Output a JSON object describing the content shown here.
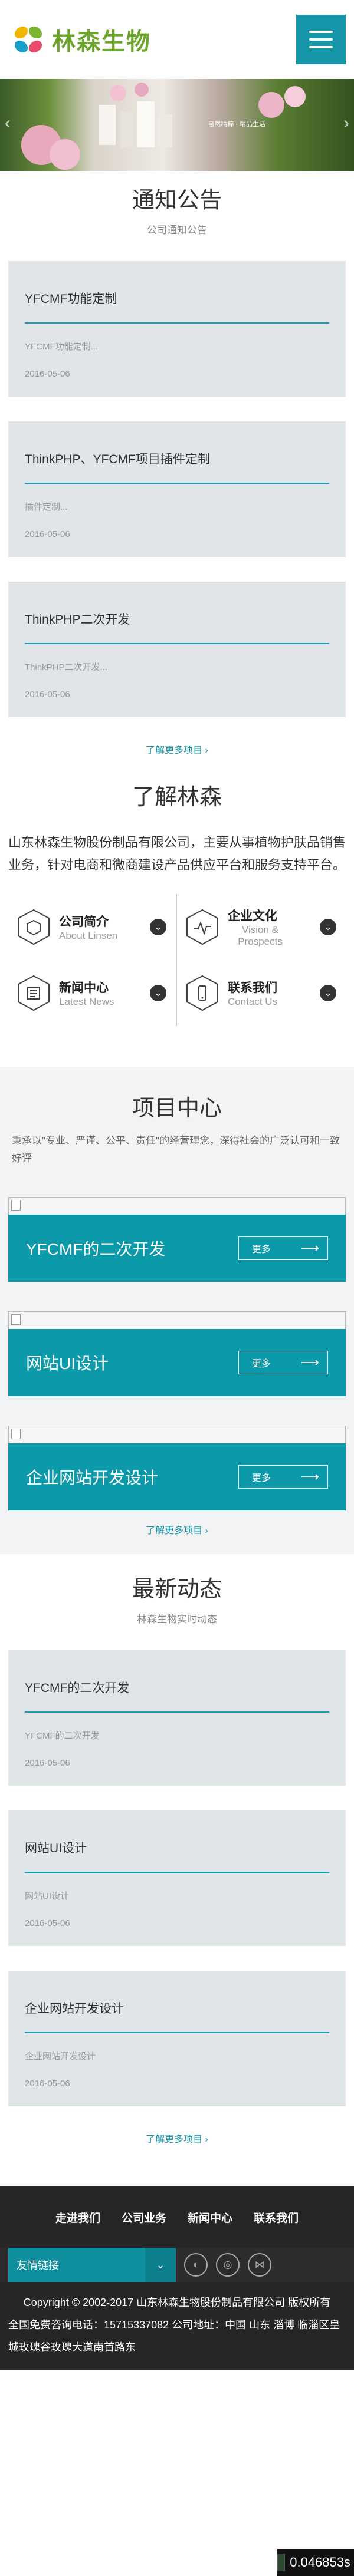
{
  "header": {
    "logo_text": "林森生物",
    "brand_color": "#6aa42a",
    "accent_color": "#1696a8",
    "menu_icon": "hamburger-icon"
  },
  "banner": {
    "caption": "自然精粹 · 精品生活",
    "caption_small": ""
  },
  "notice": {
    "title": "通知公告",
    "subtitle": "公司通知公告",
    "items": [
      {
        "title": "YFCMF功能定制",
        "desc": "YFCMF功能定制...",
        "date": "2016-05-06"
      },
      {
        "title": "ThinkPHP、YFCMF项目插件定制",
        "desc": "插件定制...",
        "date": "2016-05-06"
      },
      {
        "title": "ThinkPHP二次开发",
        "desc": "ThinkPHP二次开发...",
        "date": "2016-05-06"
      }
    ],
    "more": "了解更多项目 ›"
  },
  "about": {
    "title": "了解林森",
    "text": "山东林森生物股份制品有限公司，主要从事植物护肤品销售业务，针对电商和微商建设产品供应平台和服务支持平台。",
    "items": [
      {
        "label": "公司简介",
        "en": "About Linsen",
        "icon": "cube-icon"
      },
      {
        "label": "企业文化",
        "en": "Vision & Prospects",
        "icon": "pulse-icon"
      },
      {
        "label": "新闻中心",
        "en": "Latest News",
        "icon": "newspaper-icon"
      },
      {
        "label": "联系我们",
        "en": "Contact Us",
        "icon": "phone-icon"
      }
    ]
  },
  "projects": {
    "title": "项目中心",
    "intro": "秉承以\"专业、严谨、公平、责任\"的经营理念，深得社会的广泛认可和一致好评",
    "items": [
      {
        "name": "YFCMF的二次开发",
        "more": "更多"
      },
      {
        "name": "网站UI设计",
        "more": "更多"
      },
      {
        "name": "企业网站开发设计",
        "more": "更多"
      }
    ],
    "more": "了解更多项目 ›"
  },
  "news": {
    "title": "最新动态",
    "subtitle": "林森生物实时动态",
    "items": [
      {
        "title": "YFCMF的二次开发",
        "desc": "YFCMF的二次开发",
        "date": "2016-05-06"
      },
      {
        "title": "网站UI设计",
        "desc": "网站UI设计",
        "date": "2016-05-06"
      },
      {
        "title": "企业网站开发设计",
        "desc": "企业网站开发设计",
        "date": "2016-05-06"
      }
    ],
    "more": "了解更多项目 ›"
  },
  "footer": {
    "nav": [
      "走进我们",
      "公司业务",
      "新闻中心",
      "联系我们"
    ],
    "friend_links": "友情链接",
    "share_icons": [
      "wechat-icon",
      "weibo-icon",
      "share-icon"
    ],
    "copyright": "Copyright © 2002-2017 山东林森生物股份制品有限公司 版权所有",
    "address": "全国免费咨询电话：15715337082  公司地址：中国 山东 淄博 临淄区皇城玫瑰谷玫瑰大道南首路东",
    "timer": "0.046853s"
  }
}
